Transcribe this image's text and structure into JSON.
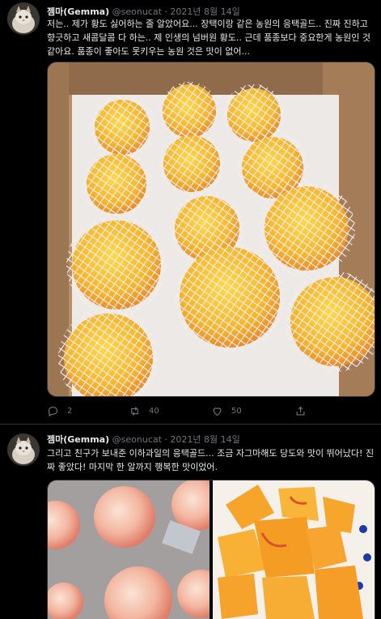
{
  "tweets": [
    {
      "author": "젬마(Gemma)",
      "handle": "@seonucat",
      "separator": "·",
      "date": "2021년 8월 14일",
      "text": "저는.. 제가 황도 싫어하는 줄 알았어요... 장택이랑 같은 농원의 응택골드.. 진짜 진하고 향긋하고 새콤달콤 다 하는.. 제 인생의 넘버원 황도.. 근데 품종보다 중요한게 농원인 것 같아요. 품종이 좋아도 못키우는 농원 것은 맛이 없어...",
      "replies": "2",
      "retweets": "40",
      "likes": "50"
    },
    {
      "author": "젬마(Gemma)",
      "handle": "@seonucat",
      "separator": "·",
      "date": "2021년 8월 14일",
      "text": "그리고 친구가 보내준 이하과일의 응택골드... 조금 자그마해도 당도와 맛이 뛰어났다! 진짜 좋았다! 마지막 한 알까지 행복한 맛이었어."
    }
  ],
  "icons": {
    "reply": "reply-icon",
    "retweet": "retweet-icon",
    "like": "heart-icon",
    "share": "share-icon"
  },
  "colors": {
    "background": "#000000",
    "text": "#e7e9ea",
    "muted": "#71767b",
    "divider": "#2f3336"
  }
}
